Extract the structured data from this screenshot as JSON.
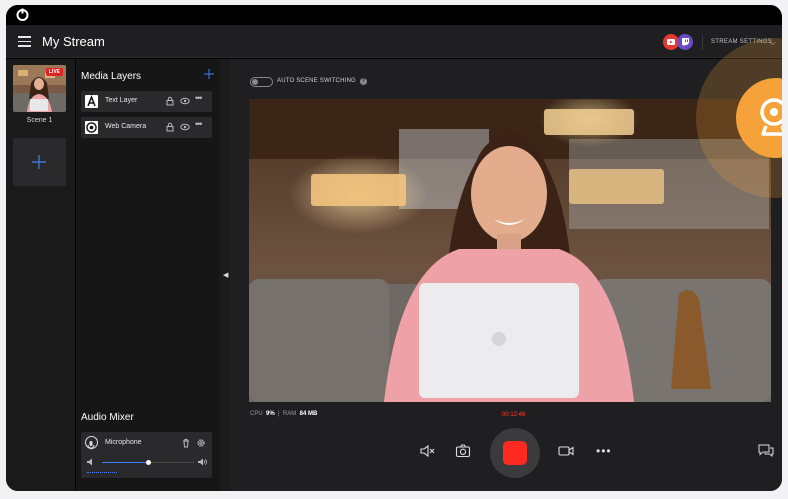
{
  "app": {
    "title": "My Stream"
  },
  "header": {
    "platforms": [
      {
        "icon": "youtube-icon",
        "color": "#e53935"
      },
      {
        "icon": "twitch-icon",
        "color": "#6b4bc4"
      }
    ],
    "settings_label": "STREAM SETTINGS"
  },
  "scenes": [
    {
      "label": "Scene 1",
      "badge": "LIVE"
    }
  ],
  "media_layers": {
    "title": "Media Layers",
    "items": [
      {
        "label": "Text Layer",
        "icon": "text-layer-icon"
      },
      {
        "label": "Web Camera",
        "icon": "web-camera-icon"
      }
    ]
  },
  "audio_mixer": {
    "title": "Audio Mixer",
    "items": [
      {
        "label": "Microphone",
        "volume": 0.5
      }
    ]
  },
  "scene_switch": {
    "label": "AUTO SCENE SWITCHING",
    "enabled": false
  },
  "stats": {
    "cpu_label": "CPU",
    "cpu_value": "9%",
    "ram_label": "RAM",
    "ram_value": "84 MB"
  },
  "recording": {
    "time": "00:12:46"
  },
  "colors": {
    "accent": "#3b82f6",
    "record": "#ff2a1f",
    "live": "#e02424",
    "cam_badge": "#f5a23a"
  }
}
